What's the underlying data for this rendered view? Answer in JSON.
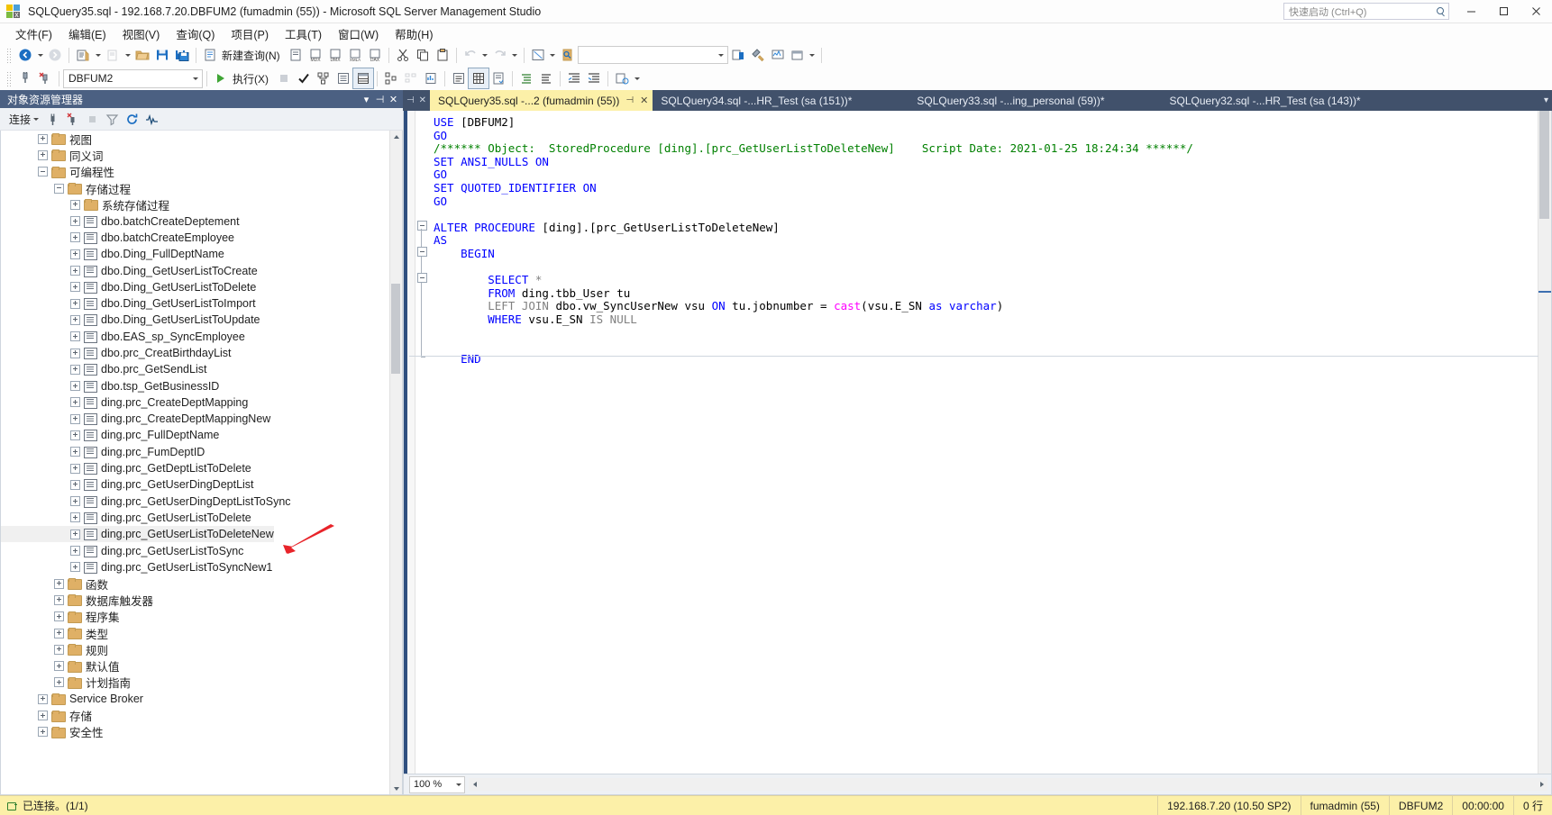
{
  "window": {
    "title": "SQLQuery35.sql - 192.168.7.20.DBFUM2 (fumadmin (55)) - Microsoft SQL Server Management Studio",
    "logo_letter": "x",
    "quick_launch_placeholder": "快速启动 (Ctrl+Q)",
    "minimize_label": "最小化",
    "maximize_label": "最大化",
    "close_label": "关闭"
  },
  "menubar": {
    "items": [
      {
        "label": "文件(F)"
      },
      {
        "label": "编辑(E)"
      },
      {
        "label": "视图(V)"
      },
      {
        "label": "查询(Q)"
      },
      {
        "label": "项目(P)"
      },
      {
        "label": "工具(T)"
      },
      {
        "label": "窗口(W)"
      },
      {
        "label": "帮助(H)"
      }
    ]
  },
  "toolbar_standard": {
    "new_query_label": "新建查询(N)",
    "mdx_label": "MDX",
    "dmx_label": "DMX",
    "xmla_label": "XMLA",
    "dax_label": "DAX",
    "find_placeholder": ""
  },
  "toolbar_editor": {
    "database_value": "DBFUM2",
    "execute_label": "执行(X)"
  },
  "object_explorer": {
    "title": "对象资源管理器",
    "connect_label": "连接",
    "tree": [
      {
        "label": "视图",
        "depth": 2,
        "type": "folder",
        "expander": "plus"
      },
      {
        "label": "同义词",
        "depth": 2,
        "type": "folder",
        "expander": "plus"
      },
      {
        "label": "可编程性",
        "depth": 2,
        "type": "folder",
        "expander": "minus"
      },
      {
        "label": "存储过程",
        "depth": 3,
        "type": "folder",
        "expander": "minus"
      },
      {
        "label": "系统存储过程",
        "depth": 4,
        "type": "folder",
        "expander": "plus"
      },
      {
        "label": "dbo.batchCreateDeptement",
        "depth": 4,
        "type": "proc",
        "expander": "plus"
      },
      {
        "label": "dbo.batchCreateEmployee",
        "depth": 4,
        "type": "proc",
        "expander": "plus"
      },
      {
        "label": "dbo.Ding_FullDeptName",
        "depth": 4,
        "type": "proc",
        "expander": "plus"
      },
      {
        "label": "dbo.Ding_GetUserListToCreate",
        "depth": 4,
        "type": "proc",
        "expander": "plus"
      },
      {
        "label": "dbo.Ding_GetUserListToDelete",
        "depth": 4,
        "type": "proc",
        "expander": "plus"
      },
      {
        "label": "dbo.Ding_GetUserListToImport",
        "depth": 4,
        "type": "proc",
        "expander": "plus"
      },
      {
        "label": "dbo.Ding_GetUserListToUpdate",
        "depth": 4,
        "type": "proc",
        "expander": "plus"
      },
      {
        "label": "dbo.EAS_sp_SyncEmployee",
        "depth": 4,
        "type": "proc",
        "expander": "plus"
      },
      {
        "label": "dbo.prc_CreatBirthdayList",
        "depth": 4,
        "type": "proc",
        "expander": "plus"
      },
      {
        "label": "dbo.prc_GetSendList",
        "depth": 4,
        "type": "proc",
        "expander": "plus"
      },
      {
        "label": "dbo.tsp_GetBusinessID",
        "depth": 4,
        "type": "proc",
        "expander": "plus"
      },
      {
        "label": "ding.prc_CreateDeptMapping",
        "depth": 4,
        "type": "proc",
        "expander": "plus"
      },
      {
        "label": "ding.prc_CreateDeptMappingNew",
        "depth": 4,
        "type": "proc",
        "expander": "plus"
      },
      {
        "label": "ding.prc_FullDeptName",
        "depth": 4,
        "type": "proc",
        "expander": "plus"
      },
      {
        "label": "ding.prc_FumDeptID",
        "depth": 4,
        "type": "proc",
        "expander": "plus"
      },
      {
        "label": "ding.prc_GetDeptListToDelete",
        "depth": 4,
        "type": "proc",
        "expander": "plus"
      },
      {
        "label": "ding.prc_GetUserDingDeptList",
        "depth": 4,
        "type": "proc",
        "expander": "plus"
      },
      {
        "label": "ding.prc_GetUserDingDeptListToSync",
        "depth": 4,
        "type": "proc",
        "expander": "plus"
      },
      {
        "label": "ding.prc_GetUserListToDelete",
        "depth": 4,
        "type": "proc",
        "expander": "plus"
      },
      {
        "label": "ding.prc_GetUserListToDeleteNew",
        "depth": 4,
        "type": "proc",
        "expander": "plus",
        "selected": true
      },
      {
        "label": "ding.prc_GetUserListToSync",
        "depth": 4,
        "type": "proc",
        "expander": "plus"
      },
      {
        "label": "ding.prc_GetUserListToSyncNew1",
        "depth": 4,
        "type": "proc",
        "expander": "plus"
      },
      {
        "label": "函数",
        "depth": 3,
        "type": "folder",
        "expander": "plus"
      },
      {
        "label": "数据库触发器",
        "depth": 3,
        "type": "folder",
        "expander": "plus"
      },
      {
        "label": "程序集",
        "depth": 3,
        "type": "folder",
        "expander": "plus"
      },
      {
        "label": "类型",
        "depth": 3,
        "type": "folder",
        "expander": "plus"
      },
      {
        "label": "规则",
        "depth": 3,
        "type": "folder",
        "expander": "plus"
      },
      {
        "label": "默认值",
        "depth": 3,
        "type": "folder",
        "expander": "plus"
      },
      {
        "label": "计划指南",
        "depth": 3,
        "type": "folder",
        "expander": "plus"
      },
      {
        "label": "Service Broker",
        "depth": 2,
        "type": "folder",
        "expander": "plus"
      },
      {
        "label": "存储",
        "depth": 2,
        "type": "folder",
        "expander": "plus"
      },
      {
        "label": "安全性",
        "depth": 2,
        "type": "folder",
        "expander": "plus"
      }
    ]
  },
  "tabs": [
    {
      "label": "SQLQuery35.sql -...2 (fumadmin (55))",
      "active": true
    },
    {
      "label": "SQLQuery34.sql -...HR_Test (sa (151))*",
      "active": false
    },
    {
      "label": "SQLQuery33.sql -...ing_personal (59))*",
      "active": false
    },
    {
      "label": "SQLQuery32.sql -...HR_Test (sa (143))*",
      "active": false
    }
  ],
  "editor": {
    "zoom": "100 %",
    "lines": [
      [
        {
          "t": "USE",
          "c": "kw"
        },
        {
          "t": " [DBFUM2]",
          "c": "pl"
        }
      ],
      [
        {
          "t": "GO",
          "c": "kw"
        }
      ],
      [
        {
          "t": "/****** Object:  StoredProcedure [ding].[prc_GetUserListToDeleteNew]    Script Date: 2021-01-25 18:24:34 ******/",
          "c": "cmt"
        }
      ],
      [
        {
          "t": "SET ANSI_NULLS ON",
          "c": "kw"
        }
      ],
      [
        {
          "t": "GO",
          "c": "kw"
        }
      ],
      [
        {
          "t": "SET QUOTED_IDENTIFIER ON",
          "c": "kw"
        }
      ],
      [
        {
          "t": "GO",
          "c": "kw"
        }
      ],
      [
        {
          "t": "",
          "c": "pl"
        }
      ],
      [
        {
          "t": "ALTER PROCEDURE",
          "c": "kw"
        },
        {
          "t": " [ding].[prc_GetUserListToDeleteNew]",
          "c": "pl"
        }
      ],
      [
        {
          "t": "AS",
          "c": "kw"
        }
      ],
      [
        {
          "t": "    BEGIN",
          "c": "kw"
        }
      ],
      [
        {
          "t": "",
          "c": "pl"
        }
      ],
      [
        {
          "t": "        SELECT",
          "c": "kw"
        },
        {
          "t": " *",
          "c": "gr"
        }
      ],
      [
        {
          "t": "        FROM",
          "c": "kw"
        },
        {
          "t": " ding.tbb_User tu",
          "c": "pl"
        }
      ],
      [
        {
          "t": "        ",
          "c": "pl"
        },
        {
          "t": "LEFT JOIN",
          "c": "gr"
        },
        {
          "t": " dbo.vw_SyncUserNew vsu ",
          "c": "pl"
        },
        {
          "t": "ON",
          "c": "kw"
        },
        {
          "t": " tu.jobnumber = ",
          "c": "pl"
        },
        {
          "t": "cast",
          "c": "fn"
        },
        {
          "t": "(vsu.E_SN ",
          "c": "pl"
        },
        {
          "t": "as",
          "c": "kw"
        },
        {
          "t": " ",
          "c": "pl"
        },
        {
          "t": "varchar",
          "c": "kw"
        },
        {
          "t": ")",
          "c": "pl"
        }
      ],
      [
        {
          "t": "        WHERE",
          "c": "kw"
        },
        {
          "t": " vsu.E_SN ",
          "c": "pl"
        },
        {
          "t": "IS NULL",
          "c": "gr"
        }
      ],
      [
        {
          "t": "",
          "c": "pl"
        }
      ],
      [
        {
          "t": "",
          "c": "pl"
        }
      ],
      [
        {
          "t": "    END",
          "c": "kw"
        }
      ]
    ]
  },
  "statusbar": {
    "connected": "已连接。(1/1)",
    "server": "192.168.7.20 (10.50 SP2)",
    "user": "fumadmin (55)",
    "database": "DBFUM2",
    "elapsed": "00:00:00",
    "rows": "0 行"
  }
}
